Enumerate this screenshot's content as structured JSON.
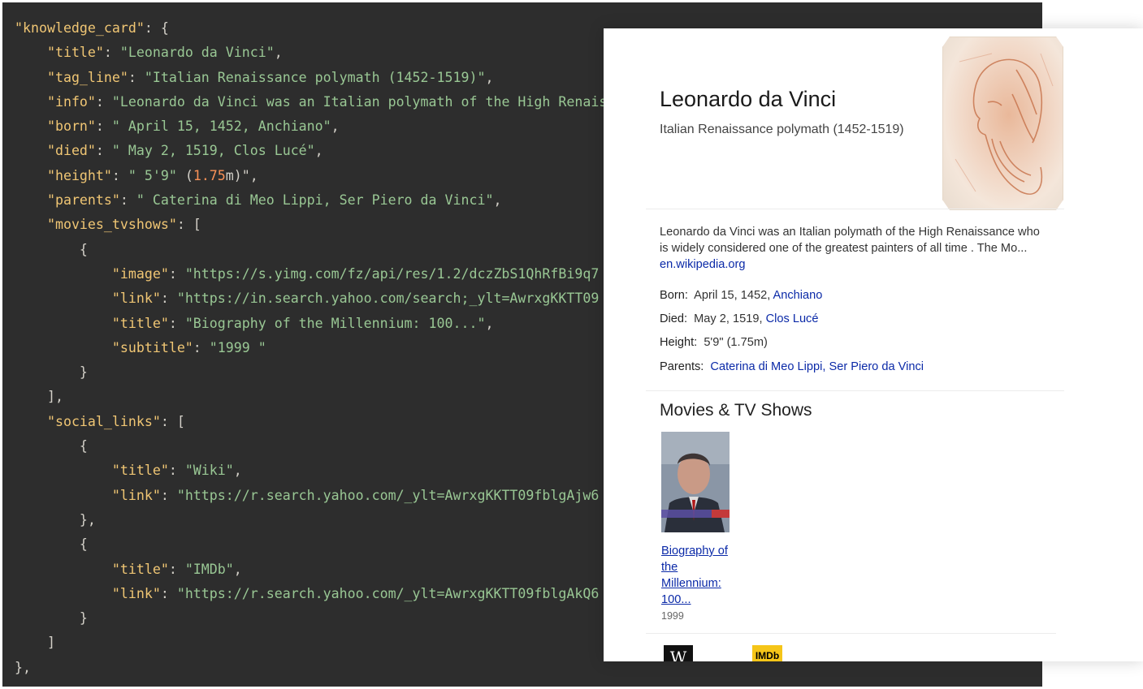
{
  "code_lines": [
    [
      {
        "t": "p",
        "v": ""
      },
      {
        "t": "k",
        "v": "\"knowledge_card\""
      },
      {
        "t": "p",
        "v": ": {"
      }
    ],
    [
      {
        "t": "p",
        "v": "    "
      },
      {
        "t": "k",
        "v": "\"title\""
      },
      {
        "t": "p",
        "v": ": "
      },
      {
        "t": "s",
        "v": "\"Leonardo da Vinci\""
      },
      {
        "t": "p",
        "v": ","
      }
    ],
    [
      {
        "t": "p",
        "v": "    "
      },
      {
        "t": "k",
        "v": "\"tag_line\""
      },
      {
        "t": "p",
        "v": ": "
      },
      {
        "t": "s",
        "v": "\"Italian Renaissance polymath (1452-1519)\""
      },
      {
        "t": "p",
        "v": ","
      }
    ],
    [
      {
        "t": "p",
        "v": "    "
      },
      {
        "t": "k",
        "v": "\"info\""
      },
      {
        "t": "p",
        "v": ": "
      },
      {
        "t": "s",
        "v": "\"Leonardo da Vinci was an Italian polymath of the High Renaissance"
      }
    ],
    [
      {
        "t": "p",
        "v": "    "
      },
      {
        "t": "k",
        "v": "\"born\""
      },
      {
        "t": "p",
        "v": ": "
      },
      {
        "t": "s",
        "v": "\" April 15, 1452, Anchiano\""
      },
      {
        "t": "p",
        "v": ","
      }
    ],
    [
      {
        "t": "p",
        "v": "    "
      },
      {
        "t": "k",
        "v": "\"died\""
      },
      {
        "t": "p",
        "v": ": "
      },
      {
        "t": "s",
        "v": "\" May 2, 1519, Clos Lucé\""
      },
      {
        "t": "p",
        "v": ","
      }
    ],
    [
      {
        "t": "p",
        "v": "    "
      },
      {
        "t": "k",
        "v": "\"height\""
      },
      {
        "t": "p",
        "v": ": "
      },
      {
        "t": "s",
        "v": "\" 5'9\""
      },
      {
        "t": "p",
        "v": " ("
      },
      {
        "t": "n",
        "v": "1.75"
      },
      {
        "t": "p",
        "v": "m)\","
      }
    ],
    [
      {
        "t": "p",
        "v": "    "
      },
      {
        "t": "k",
        "v": "\"parents\""
      },
      {
        "t": "p",
        "v": ": "
      },
      {
        "t": "s",
        "v": "\" Caterina di Meo Lippi, Ser Piero da Vinci\""
      },
      {
        "t": "p",
        "v": ","
      }
    ],
    [
      {
        "t": "p",
        "v": "    "
      },
      {
        "t": "k",
        "v": "\"movies_tvshows\""
      },
      {
        "t": "p",
        "v": ": ["
      }
    ],
    [
      {
        "t": "p",
        "v": "        {"
      }
    ],
    [
      {
        "t": "p",
        "v": "            "
      },
      {
        "t": "k",
        "v": "\"image\""
      },
      {
        "t": "p",
        "v": ": "
      },
      {
        "t": "s",
        "v": "\"https://s.yimg.com/fz/api/res/1.2/dczZbS1QhRfBi9q7"
      }
    ],
    [
      {
        "t": "p",
        "v": "            "
      },
      {
        "t": "k",
        "v": "\"link\""
      },
      {
        "t": "p",
        "v": ": "
      },
      {
        "t": "s",
        "v": "\"https://in.search.yahoo.com/search;_ylt=AwrxgKKTT09"
      }
    ],
    [
      {
        "t": "p",
        "v": "            "
      },
      {
        "t": "k",
        "v": "\"title\""
      },
      {
        "t": "p",
        "v": ": "
      },
      {
        "t": "s",
        "v": "\"Biography of the Millennium: 100...\""
      },
      {
        "t": "p",
        "v": ","
      }
    ],
    [
      {
        "t": "p",
        "v": "            "
      },
      {
        "t": "k",
        "v": "\"subtitle\""
      },
      {
        "t": "p",
        "v": ": "
      },
      {
        "t": "s",
        "v": "\"1999 \""
      }
    ],
    [
      {
        "t": "p",
        "v": "        }"
      }
    ],
    [
      {
        "t": "p",
        "v": "    ],"
      }
    ],
    [
      {
        "t": "p",
        "v": "    "
      },
      {
        "t": "k",
        "v": "\"social_links\""
      },
      {
        "t": "p",
        "v": ": ["
      }
    ],
    [
      {
        "t": "p",
        "v": "        {"
      }
    ],
    [
      {
        "t": "p",
        "v": "            "
      },
      {
        "t": "k",
        "v": "\"title\""
      },
      {
        "t": "p",
        "v": ": "
      },
      {
        "t": "s",
        "v": "\"Wiki\""
      },
      {
        "t": "p",
        "v": ","
      }
    ],
    [
      {
        "t": "p",
        "v": "            "
      },
      {
        "t": "k",
        "v": "\"link\""
      },
      {
        "t": "p",
        "v": ": "
      },
      {
        "t": "s",
        "v": "\"https://r.search.yahoo.com/_ylt=AwrxgKKTT09fblgAjw6"
      }
    ],
    [
      {
        "t": "p",
        "v": "        },"
      }
    ],
    [
      {
        "t": "p",
        "v": "        {"
      }
    ],
    [
      {
        "t": "p",
        "v": "            "
      },
      {
        "t": "k",
        "v": "\"title\""
      },
      {
        "t": "p",
        "v": ": "
      },
      {
        "t": "s",
        "v": "\"IMDb\""
      },
      {
        "t": "p",
        "v": ","
      }
    ],
    [
      {
        "t": "p",
        "v": "            "
      },
      {
        "t": "k",
        "v": "\"link\""
      },
      {
        "t": "p",
        "v": ": "
      },
      {
        "t": "s",
        "v": "\"https://r.search.yahoo.com/_ylt=AwrxgKKTT09fblgAkQ6"
      }
    ],
    [
      {
        "t": "p",
        "v": "        }"
      }
    ],
    [
      {
        "t": "p",
        "v": "    ]"
      }
    ],
    [
      {
        "t": "p",
        "v": "},"
      }
    ]
  ],
  "colors": {
    "editor_bg": "#2d2d2d",
    "key": "#f0c674",
    "string": "#99c794",
    "number": "#f99157",
    "punct": "#d3d0c8",
    "link": "#0b2aa8"
  },
  "card": {
    "title": "Leonardo da Vinci",
    "tag_line": "Italian Renaissance polymath (1452-1519)",
    "info": "Leonardo da Vinci was an Italian polymath of the High Renaissance who is widely considered one of the greatest painters of all time . The Mo...",
    "info_source": "en.wikipedia.org",
    "born_label": "Born:",
    "born_value": "April 15, 1452,",
    "born_link": "Anchiano",
    "died_label": "Died:",
    "died_value": "May 2, 1519,",
    "died_link": "Clos Lucé",
    "height_label": "Height:",
    "height_value": "5'9\" (1.75m)",
    "parents_label": "Parents:",
    "parent_1": "Caterina di Meo Lippi",
    "parent_sep": ",",
    "parent_2": "Ser Piero da Vinci",
    "movies_heading": "Movies & TV Shows",
    "movie_title": "Biography of the Millennium: 100...",
    "movie_subtitle": "1999",
    "social": {
      "wiki_glyph": "W",
      "imdb_glyph": "IMDb"
    }
  }
}
